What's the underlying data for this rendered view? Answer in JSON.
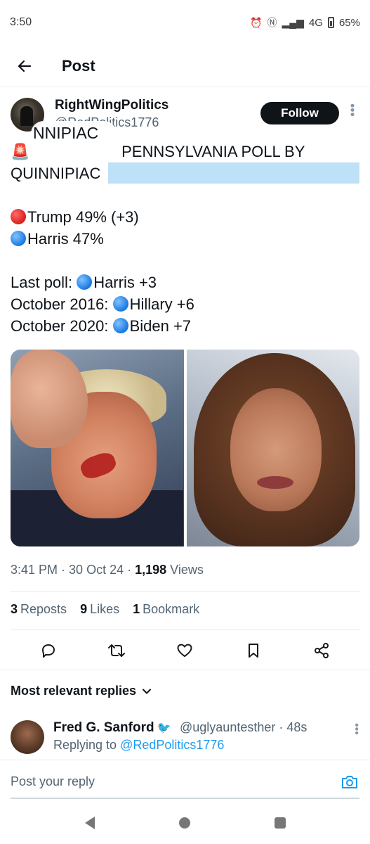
{
  "status_bar": {
    "time": "3:50",
    "network": "4G",
    "battery": "65%"
  },
  "header": {
    "title": "Post"
  },
  "post": {
    "author_name": "RightWingPolitics",
    "author_handle": "@RedPolitics1776",
    "follow_label": "Follow",
    "overlay_text": "NNIPIAC",
    "text_line1": "PENNSYLVANIA POLL BY",
    "text_line2": "QUINNIPIAC",
    "trump": "Trump 49% (+3)",
    "harris": "Harris 47%",
    "last_poll_prefix": "Last poll:",
    "last_poll_value": "Harris +3",
    "oct2016_prefix": "October 2016:",
    "oct2016_value": "Hillary +6",
    "oct2020_prefix": "October 2020:",
    "oct2020_value": "Biden +7",
    "time": "3:41 PM",
    "date": "30 Oct 24",
    "views_count": "1,198",
    "views_label": "Views",
    "reposts_count": "3",
    "reposts_label": "Reposts",
    "likes_count": "9",
    "likes_label": "Likes",
    "bookmarks_count": "1",
    "bookmarks_label": "Bookmark"
  },
  "replies": {
    "sort_label": "Most relevant replies",
    "items": [
      {
        "name": "Fred G. Sanford",
        "handle": "@uglyauntesther",
        "age": "48s",
        "replying_prefix": "Replying to",
        "replying_to": "@RedPolitics1776"
      }
    ]
  },
  "compose": {
    "placeholder": "Post your reply"
  },
  "colors": {
    "accent": "#1d9bf0",
    "follow_bg": "#0f1419",
    "highlight": "#bfe1f8"
  }
}
